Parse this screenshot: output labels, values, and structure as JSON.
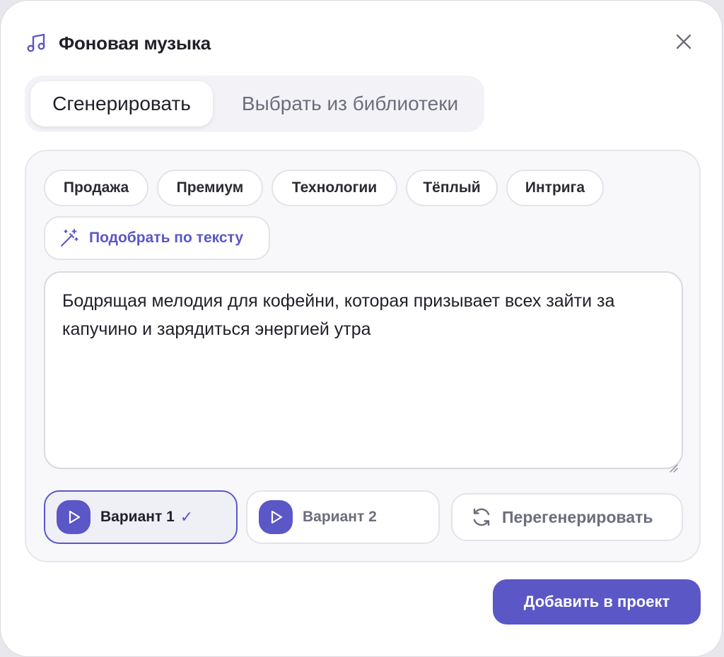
{
  "header": {
    "title": "Фоновая музыка",
    "icon": "music-note-icon",
    "close_icon": "close-icon"
  },
  "tabs": [
    {
      "label": "Сгенерировать",
      "active": true
    },
    {
      "label": "Выбрать из библиотеки",
      "active": false
    }
  ],
  "chips": [
    {
      "label": "Продажа"
    },
    {
      "label": "Премиум"
    },
    {
      "label": "Технологии"
    },
    {
      "label": "Тёплый"
    },
    {
      "label": "Интрига"
    }
  ],
  "match_button": {
    "label": "Подобрать по тексту",
    "icon": "magic-wand-icon"
  },
  "prompt": {
    "value": "Бодрящая мелодия для кофейни, которая призывает всех зайти за капучино и зарядиться энергией утра"
  },
  "variants": [
    {
      "label": "Вариант 1",
      "selected": true,
      "check": "✓"
    },
    {
      "label": "Вариант 2",
      "selected": false
    }
  ],
  "regenerate_button": {
    "label": "Перегенерировать",
    "icon": "refresh-icon"
  },
  "add_button": {
    "label": "Добавить в проект"
  },
  "colors": {
    "accent": "#5b57c7",
    "text": "#1f2029",
    "muted": "#6c6e7c"
  }
}
